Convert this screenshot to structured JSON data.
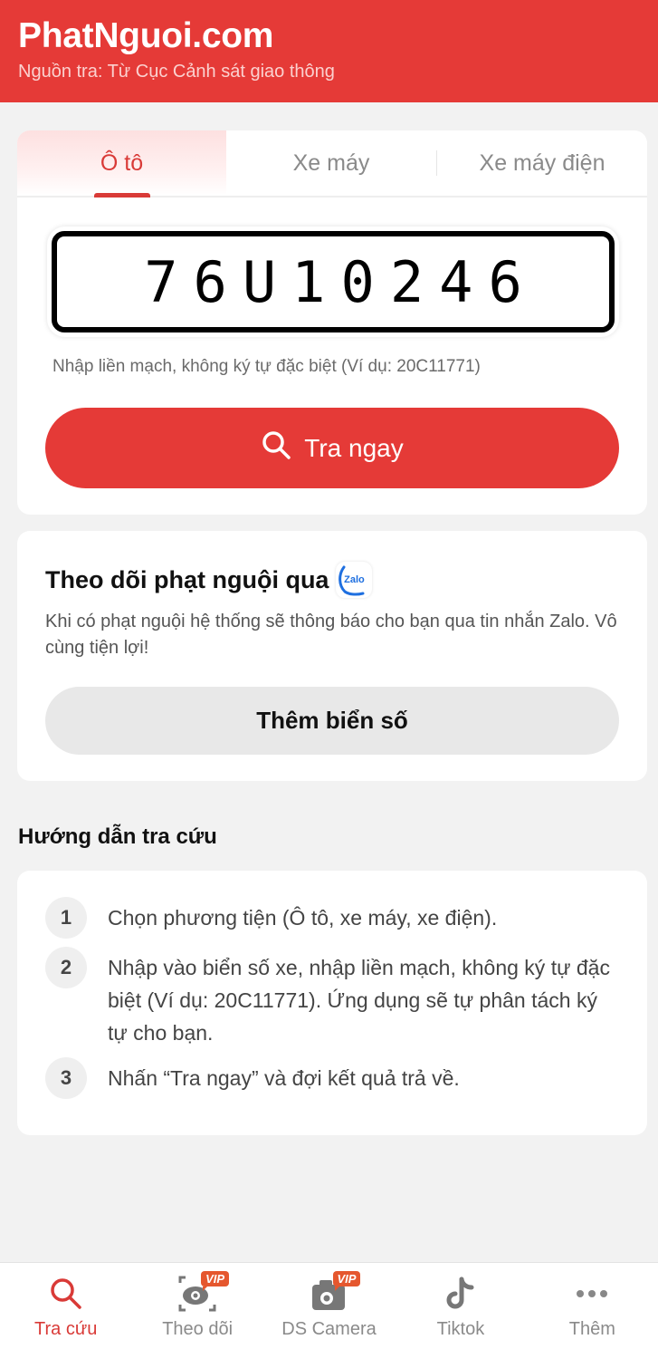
{
  "header": {
    "title": "PhatNguoi.com",
    "subtitle": "Nguồn tra: Từ Cục Cảnh sát giao thông",
    "brand_color": "#e53a37"
  },
  "search": {
    "tabs": [
      {
        "label": "Ô tô",
        "active": true
      },
      {
        "label": "Xe máy",
        "active": false
      },
      {
        "label": "Xe máy điện",
        "active": false
      }
    ],
    "plate_value": "76U10246",
    "hint": "Nhập liền mạch, không ký tự đặc biệt (Ví dụ: 20C11771)",
    "button_label": "Tra ngay",
    "button_icon": "search-icon"
  },
  "zalo": {
    "title": "Theo dõi phạt nguội qua",
    "badge_text": "Zalo",
    "description": "Khi có phạt nguội hệ thống sẽ thông báo cho bạn qua tin nhắn Zalo. Vô cùng tiện lợi!",
    "button_label": "Thêm biển số"
  },
  "guide": {
    "title": "Hướng dẫn tra cứu",
    "steps": [
      {
        "num": "1",
        "text": "Chọn phương tiện (Ô tô, xe máy, xe điện)."
      },
      {
        "num": "2",
        "text": "Nhập vào biển số xe, nhập liền mạch, không ký tự đặc biệt (Ví dụ: 20C11771). Ứng dụng sẽ tự phân tách ký tự cho bạn."
      },
      {
        "num": "3",
        "text": "Nhấn “Tra ngay” và đợi kết quả trả về."
      }
    ]
  },
  "bottom_nav": {
    "items": [
      {
        "label": "Tra cứu",
        "icon": "search-icon",
        "active": true
      },
      {
        "label": "Theo dõi",
        "icon": "eye-scan-icon",
        "badge": "VIP"
      },
      {
        "label": "DS Camera",
        "icon": "camera-icon",
        "badge": "VIP"
      },
      {
        "label": "Tiktok",
        "icon": "tiktok-icon"
      },
      {
        "label": "Thêm",
        "icon": "more-dots-icon"
      }
    ]
  }
}
